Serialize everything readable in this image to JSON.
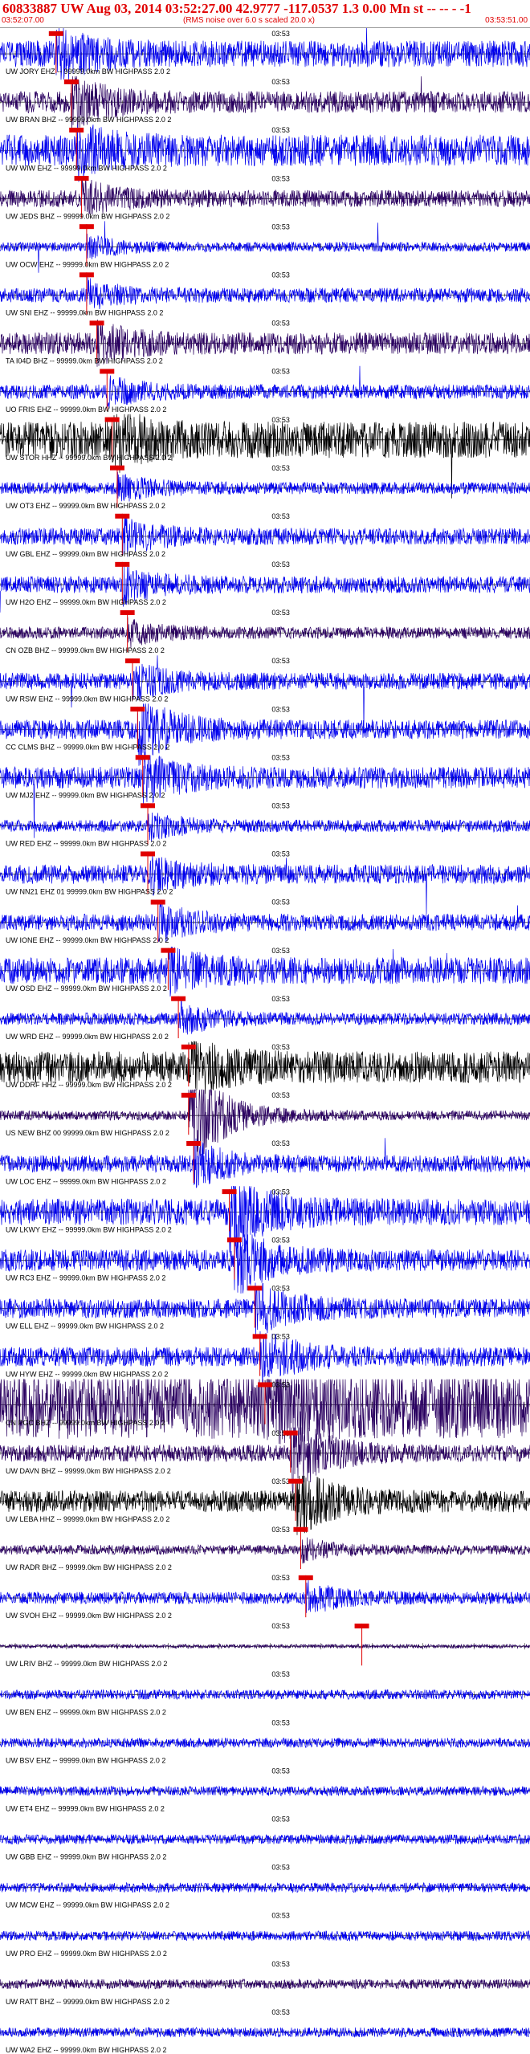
{
  "header": {
    "title": "60833887 UW Aug 03, 2014 03:52:27.00   42.9777 -117.0537  1.3 0.00 Mn st -- -- -  -1",
    "start_time": "03:52:07.00",
    "scale_note": "(RMS noise over 6.0 s scaled 20.0 x)",
    "end_time": "03:53:51.00"
  },
  "colors": {
    "blue": "#0000ee",
    "purple": "#2a0060",
    "black": "#000000",
    "pick": "#e00000",
    "header_text": "#e00000"
  },
  "chart_data": {
    "type": "line",
    "title": "",
    "time_range": [
      "03:52:07.00",
      "03:53:51.00"
    ],
    "time_tick_label": "03:53",
    "traces": [
      {
        "label": "UW JORY EHZ -- 99999.0km BW  HIGHPASS  2.0  2",
        "color": "blue",
        "amp": 0.55,
        "pick_time": "03:52:18",
        "burst": 0.2,
        "spike": 0.2
      },
      {
        "label": "UW BRAN BHZ -- 99999.0km BW  HIGHPASS  2.0  2",
        "color": "purple",
        "amp": 0.45,
        "pick_time": "03:52:21",
        "burst": 0.22,
        "spike": 0.1
      },
      {
        "label": "UW WIW EHZ -- 99999.0km BW  HIGHPASS  2.0  2",
        "color": "blue",
        "amp": 0.65,
        "pick_time": "03:52:22",
        "burst": 0.18,
        "spike": 0.3
      },
      {
        "label": "UW JEDS BHZ -- 99999.0km BW  HIGHPASS  2.0  2",
        "color": "purple",
        "amp": 0.35,
        "pick_time": "03:52:23",
        "burst": 0.15,
        "spike": 0.0
      },
      {
        "label": "UW OCW EHZ -- 99999.0km BW  HIGHPASS  2.0  2",
        "color": "blue",
        "amp": 0.2,
        "pick_time": "03:52:24",
        "burst": 0.1,
        "spike": 0.8
      },
      {
        "label": "UW SNI EHZ -- 99999.0km BW  HIGHPASS  2.0  2",
        "color": "blue",
        "amp": 0.3,
        "pick_time": "03:52:24",
        "burst": 0.12,
        "spike": 0.0
      },
      {
        "label": "TA I04D BHZ -- 99999.0km BW  HIGHPASS  2.0  2",
        "color": "purple",
        "amp": 0.45,
        "pick_time": "03:52:26",
        "burst": 0.15,
        "spike": 0.0
      },
      {
        "label": "UO FRIS EHZ -- 99999.0km BW  HIGHPASS  2.0  2",
        "color": "blue",
        "amp": 0.3,
        "pick_time": "03:52:28",
        "burst": 0.12,
        "spike": 0.1
      },
      {
        "label": "UW STOR HHZ -- 99999.0km BW  HIGHPASS  2.0  2",
        "color": "black",
        "amp": 0.75,
        "pick_time": "03:52:29",
        "burst": 0.2,
        "spike": 0.5
      },
      {
        "label": "UW OT3 EHZ -- 99999.0km BW  HIGHPASS  2.0  2",
        "color": "blue",
        "amp": 0.25,
        "pick_time": "03:52:30",
        "burst": 0.12,
        "spike": 0.1
      },
      {
        "label": "UW GBL EHZ -- 99999.0km BW  HIGHPASS  2.0  2",
        "color": "blue",
        "amp": 0.35,
        "pick_time": "03:52:31",
        "burst": 0.15,
        "spike": 0.5
      },
      {
        "label": "UW H2O EHZ -- 99999.0km BW  HIGHPASS  2.0  2",
        "color": "blue",
        "amp": 0.35,
        "pick_time": "03:52:31",
        "burst": 0.15,
        "spike": 0.5
      },
      {
        "label": "CN OZB BHZ -- 99999.0km BW  HIGHPASS  2.0  2",
        "color": "purple",
        "amp": 0.25,
        "pick_time": "03:52:32",
        "burst": 0.1,
        "spike": 0.0
      },
      {
        "label": "UW RSW EHZ -- 99999.0km BW  HIGHPASS  2.0  2",
        "color": "blue",
        "amp": 0.35,
        "pick_time": "03:52:33",
        "burst": 0.15,
        "spike": 0.4
      },
      {
        "label": "CC CLMS BHZ -- 99999.0km BW  HIGHPASS  2.0  2",
        "color": "blue",
        "amp": 0.4,
        "pick_time": "03:52:34",
        "burst": 0.3,
        "spike": 0.1
      },
      {
        "label": "UW MJ2 EHZ -- 99999.0km BW  HIGHPASS  2.0  2",
        "color": "blue",
        "amp": 0.45,
        "pick_time": "03:52:35",
        "burst": 0.2,
        "spike": 0.3
      },
      {
        "label": "UW RED EHZ -- 99999.0km BW  HIGHPASS  2.0  2",
        "color": "blue",
        "amp": 0.25,
        "pick_time": "03:52:36",
        "burst": 0.12,
        "spike": 0.1
      },
      {
        "label": "UW NN21 EHZ 01 99999.0km BW  HIGHPASS  2.0  2",
        "color": "blue",
        "amp": 0.4,
        "pick_time": "03:52:36",
        "burst": 0.15,
        "spike": 0.3
      },
      {
        "label": "UW IONE EHZ -- 99999.0km BW  HIGHPASS  2.0  2",
        "color": "blue",
        "amp": 0.35,
        "pick_time": "03:52:38",
        "burst": 0.15,
        "spike": 0.1
      },
      {
        "label": "UW OSD EHZ -- 99999.0km BW  HIGHPASS  2.0  2",
        "color": "blue",
        "amp": 0.55,
        "pick_time": "03:52:40",
        "burst": 0.15,
        "spike": 0.6
      },
      {
        "label": "UW WRD EHZ -- 99999.0km BW  HIGHPASS  2.0  2",
        "color": "blue",
        "amp": 0.25,
        "pick_time": "03:52:42",
        "burst": 0.15,
        "spike": 0.0
      },
      {
        "label": "UW DDRF HHZ -- 99999.0km BW  HIGHPASS  2.0  2",
        "color": "black",
        "amp": 0.65,
        "pick_time": "03:52:44",
        "burst": 0.2,
        "spike": 0.1
      },
      {
        "label": "US NEW BHZ 00 99999.0km BW  HIGHPASS  2.0  2",
        "color": "purple",
        "amp": 0.2,
        "pick_time": "03:52:44",
        "burst": 0.6,
        "spike": 0.0
      },
      {
        "label": "UW LOC EHZ -- 99999.0km BW  HIGHPASS  2.0  2",
        "color": "blue",
        "amp": 0.35,
        "pick_time": "03:52:45",
        "burst": 0.2,
        "spike": 0.1
      },
      {
        "label": "UW LKWY EHZ -- 99999.0km BW  HIGHPASS  2.0  2",
        "color": "blue",
        "amp": 0.55,
        "pick_time": "03:52:52",
        "burst": 0.35,
        "spike": 0.1
      },
      {
        "label": "UW RC3 EHZ -- 99999.0km BW  HIGHPASS  2.0  2",
        "color": "blue",
        "amp": 0.45,
        "pick_time": "03:52:53",
        "burst": 0.3,
        "spike": 0.1
      },
      {
        "label": "UW ELL EHZ -- 99999.0km BW  HIGHPASS  2.0  2",
        "color": "blue",
        "amp": 0.4,
        "pick_time": "03:52:57",
        "burst": 0.25,
        "spike": 0.0
      },
      {
        "label": "UW HYW EHZ -- 99999.0km BW  HIGHPASS  2.0  2",
        "color": "blue",
        "amp": 0.4,
        "pick_time": "03:52:58",
        "burst": 0.25,
        "spike": 0.0
      },
      {
        "label": "CN PGC BHZ -- 99999.0km BW  HIGHPASS  2.0  2",
        "color": "purple",
        "amp": 1.4,
        "pick_time": "03:52:59",
        "burst": 0.1,
        "spike": 0.0
      },
      {
        "label": "UW DAVN BHZ -- 99999.0km BW  HIGHPASS  2.0  2",
        "color": "purple",
        "amp": 0.35,
        "pick_time": "03:53:04",
        "burst": 0.4,
        "spike": 0.0
      },
      {
        "label": "UW LEBA HHZ -- 99999.0km BW  HIGHPASS  2.0  2",
        "color": "black",
        "amp": 0.45,
        "pick_time": "03:53:05",
        "burst": 0.3,
        "spike": 0.0
      },
      {
        "label": "UW RADR BHZ -- 99999.0km BW  HIGHPASS  2.0  2",
        "color": "purple",
        "amp": 0.2,
        "pick_time": "03:53:06",
        "burst": 0.1,
        "spike": 0.0
      },
      {
        "label": "UW SVOH EHZ -- 99999.0km BW  HIGHPASS  2.0  2",
        "color": "blue",
        "amp": 0.25,
        "pick_time": "03:53:07",
        "burst": 0.15,
        "spike": 0.0
      },
      {
        "label": "UW LRIV BHZ -- 99999.0km BW  HIGHPASS  2.0  2",
        "color": "purple",
        "amp": 0.08,
        "pick_time": "03:53:18",
        "burst": 0.0,
        "spike": 0.0
      },
      {
        "label": "UW BEN EHZ -- 99999.0km BW  HIGHPASS  2.0  2",
        "color": "blue",
        "amp": 0.2,
        "pick_time": "",
        "burst": 0.0,
        "spike": 0.0
      },
      {
        "label": "UW BSV EHZ -- 99999.0km BW  HIGHPASS  2.0  2",
        "color": "blue",
        "amp": 0.2,
        "pick_time": "",
        "burst": 0.0,
        "spike": 0.0
      },
      {
        "label": "UW ET4 EHZ -- 99999.0km BW  HIGHPASS  2.0  2",
        "color": "blue",
        "amp": 0.2,
        "pick_time": "",
        "burst": 0.0,
        "spike": 0.0
      },
      {
        "label": "UW GBB EHZ -- 99999.0km BW  HIGHPASS  2.0  2",
        "color": "blue",
        "amp": 0.2,
        "pick_time": "",
        "burst": 0.0,
        "spike": 0.0
      },
      {
        "label": "UW MCW EHZ -- 99999.0km BW  HIGHPASS  2.0  2",
        "color": "blue",
        "amp": 0.2,
        "pick_time": "",
        "burst": 0.0,
        "spike": 0.0
      },
      {
        "label": "UW PRO EHZ -- 99999.0km BW  HIGHPASS  2.0  2",
        "color": "blue",
        "amp": 0.2,
        "pick_time": "",
        "burst": 0.0,
        "spike": 0.0
      },
      {
        "label": "UW RATT BHZ -- 99999.0km BW  HIGHPASS  2.0  2",
        "color": "purple",
        "amp": 0.2,
        "pick_time": "",
        "burst": 0.0,
        "spike": 0.0
      },
      {
        "label": "UW WA2 EHZ -- 99999.0km BW  HIGHPASS  2.0  2",
        "color": "blue",
        "amp": 0.2,
        "pick_time": "",
        "burst": 0.0,
        "spike": 0.0
      }
    ]
  }
}
